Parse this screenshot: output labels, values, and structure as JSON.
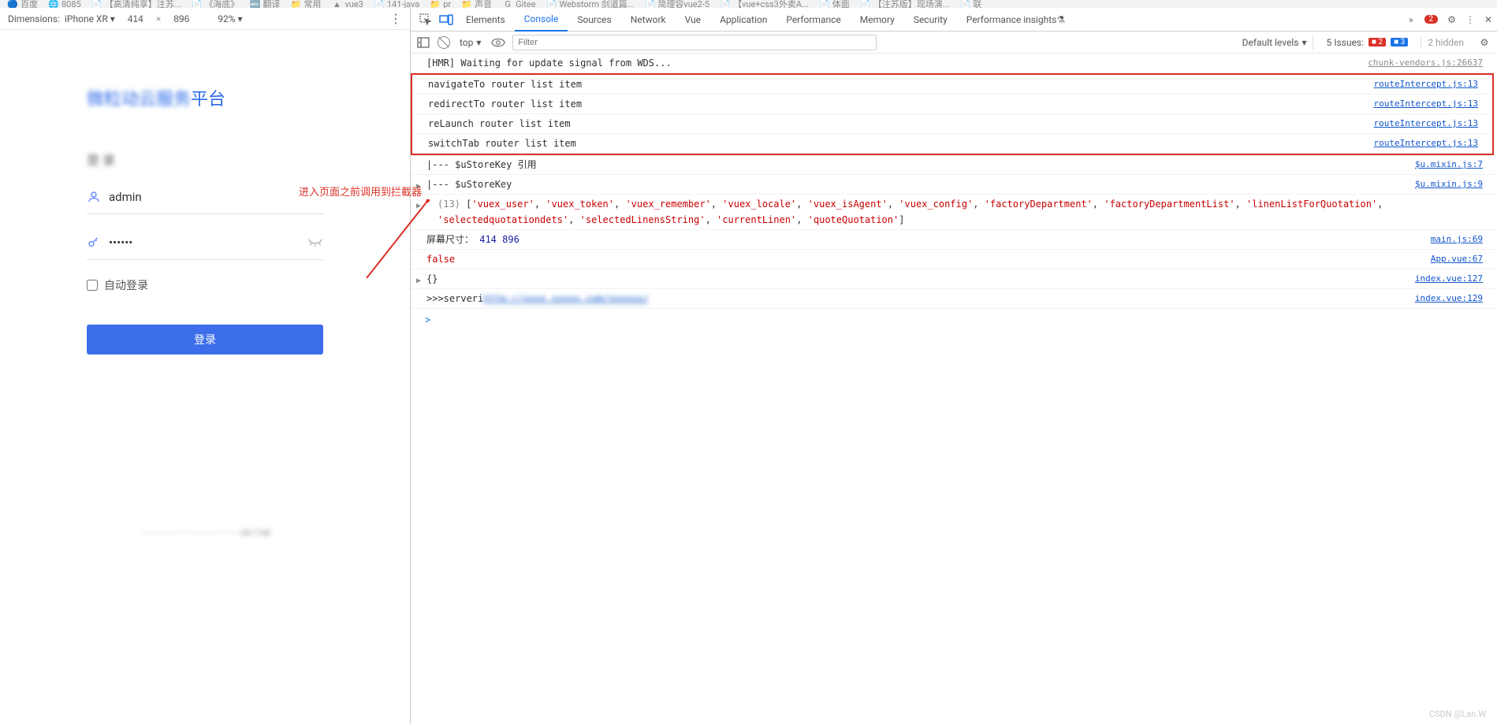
{
  "bookmarks": [
    {
      "txt": "百度",
      "ico": "🔵"
    },
    {
      "txt": "8085",
      "ico": "🌐"
    },
    {
      "txt": "【高清纯享】注苏...",
      "ico": "📄"
    },
    {
      "txt": "《海底》",
      "ico": "📄"
    },
    {
      "txt": "翻译",
      "ico": "🔤"
    },
    {
      "txt": "常用",
      "ico": "📁"
    },
    {
      "txt": "vue3",
      "ico": "▲"
    },
    {
      "txt": "141-java",
      "ico": "📄"
    },
    {
      "txt": "pr",
      "ico": "📁"
    },
    {
      "txt": "声音",
      "ico": "📁"
    },
    {
      "txt": "Gitee",
      "ico": "G"
    },
    {
      "txt": "Webstorm 剑道篇...",
      "ico": "📄"
    },
    {
      "txt": "简理容vue2-5",
      "ico": "📄"
    },
    {
      "txt": "【vue+css3外卖A...",
      "ico": "📄"
    },
    {
      "txt": "体面",
      "ico": "📄"
    },
    {
      "txt": "【注苏版】现场演...",
      "ico": "📄"
    },
    {
      "txt": "联",
      "ico": "📄"
    }
  ],
  "device_toolbar": {
    "dimensions_label": "Dimensions:",
    "device_name": "iPhone XR",
    "width": "414",
    "height": "896",
    "zoom": "92%",
    "dots": "⋮"
  },
  "login": {
    "title_blur": "微粒动云服务",
    "title_suffix": "平台",
    "subtitle_blur": "登 录",
    "username": "admin",
    "password_mask": "••••••",
    "auto_login_label": "自动登录",
    "login_btn": "登录",
    "bottom_blur": "———————————————",
    "bottom_tail": "061748"
  },
  "annotation": {
    "text": "进入页面之前调用到拦截器"
  },
  "devtools": {
    "tabs": [
      "Elements",
      "Console",
      "Sources",
      "Network",
      "Vue",
      "Application",
      "Performance",
      "Memory",
      "Security",
      "Performance insights"
    ],
    "active_tab": "Console",
    "more_icon": "»",
    "err_badge": "2",
    "gear": "⚙",
    "settings_dots": "⋮",
    "close": "✕",
    "toolbar": {
      "context": "top",
      "filter_placeholder": "Filter",
      "levels": "Default levels",
      "issues_label": "5 Issues:",
      "err_count": "2",
      "inf_count": "3",
      "hidden": "2 hidden"
    }
  },
  "logs": [
    {
      "msg_prefix": "[HMR]",
      "msg": " Waiting for update signal from WDS...",
      "src": "chunk-vendors.js:26637",
      "hl": false
    },
    {
      "msg": "navigateTo router list item",
      "src": "routeIntercept.js:13",
      "hl": true,
      "link": true
    },
    {
      "msg": "redirectTo router list item",
      "src": "routeIntercept.js:13",
      "hl": true,
      "link": true
    },
    {
      "msg": "reLaunch router list item",
      "src": "routeIntercept.js:13",
      "hl": true,
      "link": true
    },
    {
      "msg": "switchTab router list item",
      "src": "routeIntercept.js:13",
      "hl": true,
      "link": true
    },
    {
      "msg": "|--- $uStoreKey 引用",
      "src": "$u.mixin.js:7",
      "link": true
    },
    {
      "msg": "|--- $uStoreKey",
      "src": "$u.mixin.js:9",
      "link": true,
      "expand": true
    },
    {
      "italic": true,
      "array": true,
      "count": "(13)",
      "items": [
        "'vuex_user'",
        "'vuex_token'",
        "'vuex_remember'",
        "'vuex_locale'",
        "'vuex_isAgent'",
        "'vuex_config'",
        "'factoryDepartment'",
        "'factoryDepartmentList'",
        "'linenListForQuotation'",
        "'selectedquotationdets'",
        "'selectedLinensString'",
        "'currentLinen'",
        "'quoteQuotation'"
      ]
    },
    {
      "msg_prefix_plain": "屏幕尺寸：",
      "nums": "414 896",
      "src": "main.js:69",
      "link": true
    },
    {
      "msg_kw": "false",
      "src": "App.vue:67",
      "link": true
    },
    {
      "expand": true,
      "msg": "{}",
      "src": "index.vue:127",
      "link": true
    },
    {
      "msg_prefix_plain": ">>>serveri",
      "blur_url": "http://xxxx.xxxxx.com/xxxxxx/",
      "src": "index.vue:129",
      "link": true
    }
  ],
  "prompt": ">",
  "watermark": "CSDN @Lan.W"
}
